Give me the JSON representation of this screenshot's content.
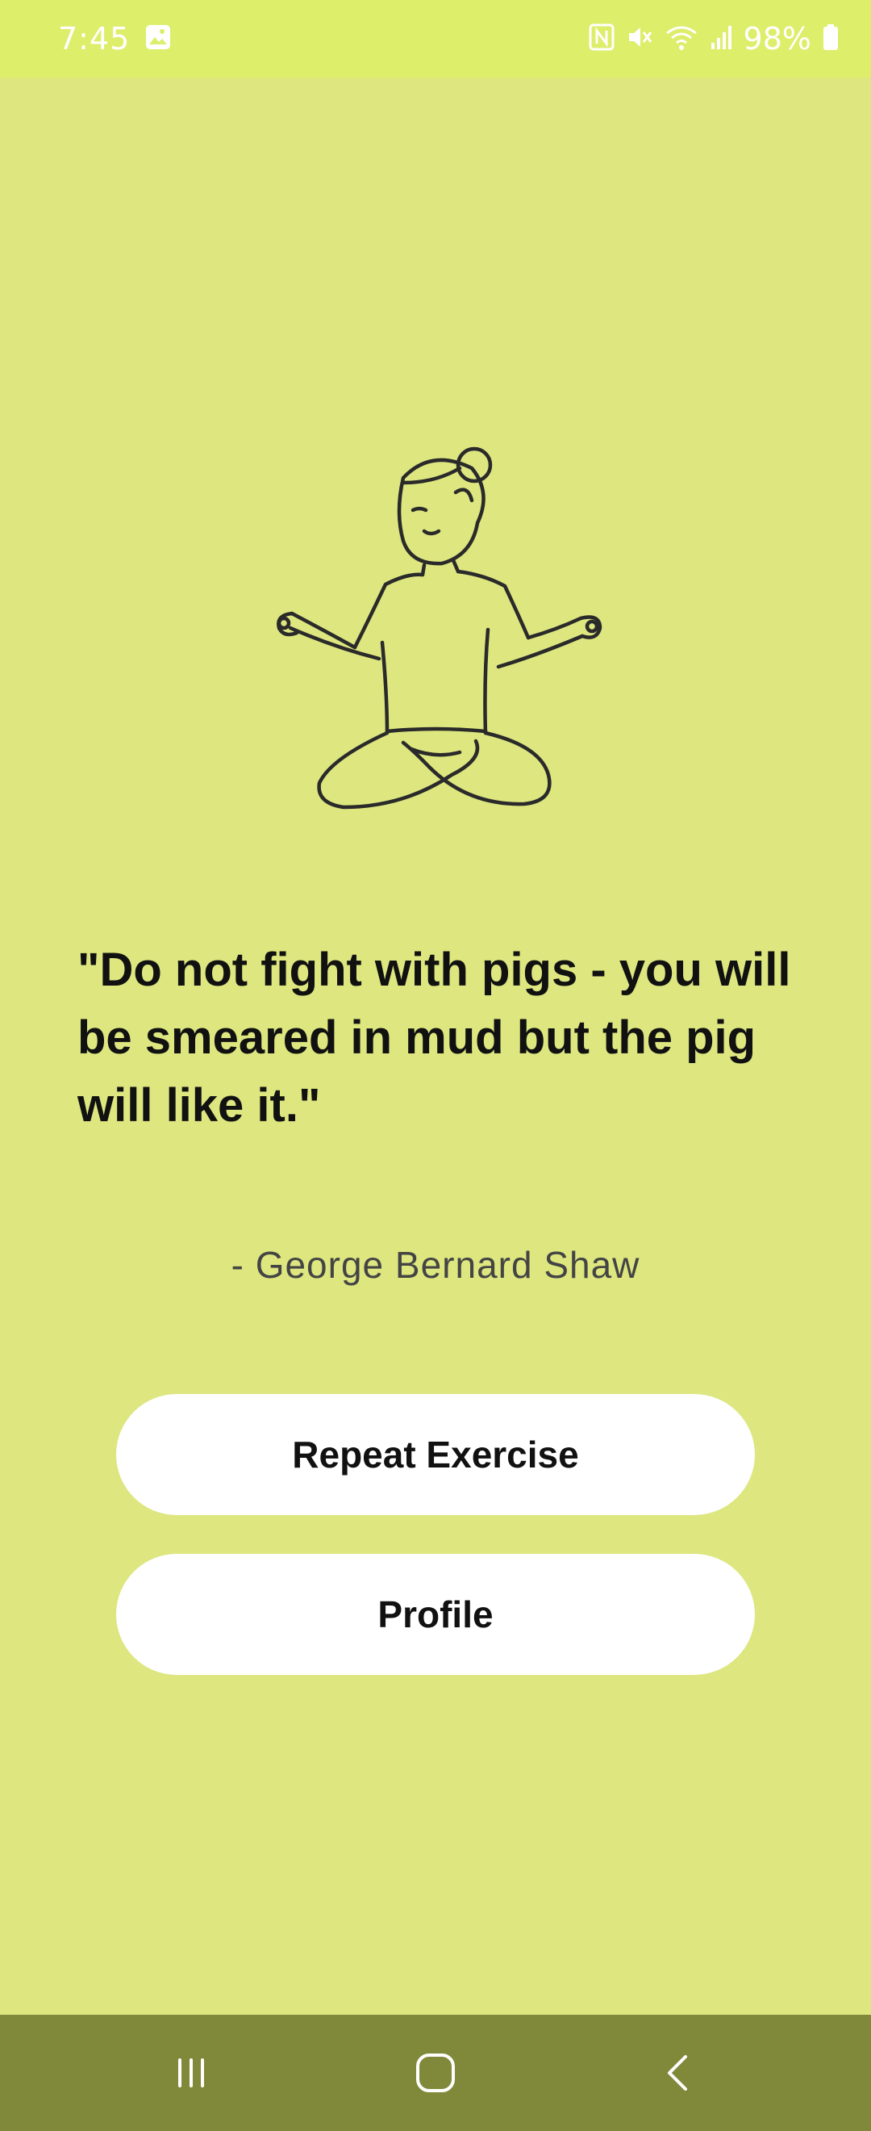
{
  "status_bar": {
    "time": "7:45",
    "battery": "98%",
    "icons": [
      "gallery-icon",
      "nfc-icon",
      "mute-icon",
      "wifi-icon",
      "signal-icon",
      "battery-icon"
    ]
  },
  "quote": {
    "text": "\"Do not fight with pigs - you will be smeared in mud but the pig will like it.\"",
    "author": "- George Bernard Shaw"
  },
  "buttons": {
    "repeat_label": "Repeat Exercise",
    "profile_label": "Profile"
  },
  "nav_bar": {
    "icons": [
      "recent-apps-icon",
      "home-icon",
      "back-icon"
    ]
  },
  "colors": {
    "background": "#dde67f",
    "status_bar": "#dcee6a",
    "nav_bar": "#80893a",
    "button": "#ffffff",
    "text": "#111111"
  }
}
